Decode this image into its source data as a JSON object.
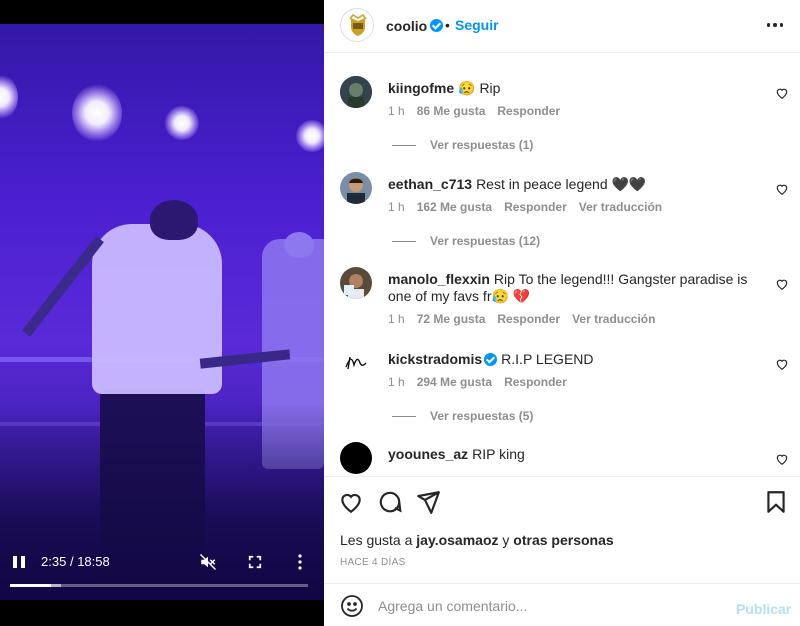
{
  "video": {
    "current_time": "2:35",
    "duration": "18:58",
    "time_separator": "/",
    "progress_fraction": 0.137,
    "buffered_fraction": 0.17,
    "icons": {
      "pause": "pause-icon",
      "mute": "volume-muted-icon",
      "fullscreen": "fullscreen-icon",
      "more": "more-vertical-icon"
    }
  },
  "header": {
    "username": "coolio",
    "verified": true,
    "separator": "•",
    "follow_label": "Seguir",
    "more_icon": "more-horizontal-icon"
  },
  "comments": [
    {
      "username": "kiingofme",
      "text": "😥 Rip",
      "time": "1 h",
      "likes": "86 Me gusta",
      "reply_label": "Responder",
      "translate_label": "",
      "replies_label": "Ver respuestas (1)",
      "verified": false
    },
    {
      "username": "eethan_c713",
      "text": "Rest in peace legend 🖤🖤",
      "time": "1 h",
      "likes": "162 Me gusta",
      "reply_label": "Responder",
      "translate_label": "Ver traducción",
      "replies_label": "Ver respuestas (12)",
      "verified": false
    },
    {
      "username": "manolo_flexxin",
      "text": "Rip To the legend!!! Gangster paradise is one of my favs fr😥 💔",
      "time": "1 h",
      "likes": "72 Me gusta",
      "reply_label": "Responder",
      "translate_label": "Ver traducción",
      "replies_label": "",
      "verified": false
    },
    {
      "username": "kickstradomis",
      "text": "R.I.P LEGEND",
      "time": "1 h",
      "likes": "294 Me gusta",
      "reply_label": "Responder",
      "translate_label": "",
      "replies_label": "Ver respuestas (5)",
      "verified": true
    },
    {
      "username": "yoounes_az",
      "text": "RIP king",
      "time": "",
      "likes": "",
      "reply_label": "",
      "translate_label": "",
      "replies_label": "",
      "verified": false
    }
  ],
  "actions": {
    "icons": {
      "like": "heart-icon",
      "comment": "comment-icon",
      "share": "send-icon",
      "save": "bookmark-icon"
    },
    "likes_prefix": "Les gusta a",
    "likes_user": "jay.osamaoz",
    "likes_connector": "y",
    "likes_others": "otras personas",
    "time_ago": "HACE 4 DÍAS"
  },
  "composer": {
    "placeholder": "Agrega un comentario...",
    "publish_label": "Publicar",
    "emoji_icon": "emoji-icon"
  },
  "colors": {
    "accent": "#0095f6",
    "publish_disabled": "#b2dffc",
    "stage": "#4a1fd0"
  }
}
